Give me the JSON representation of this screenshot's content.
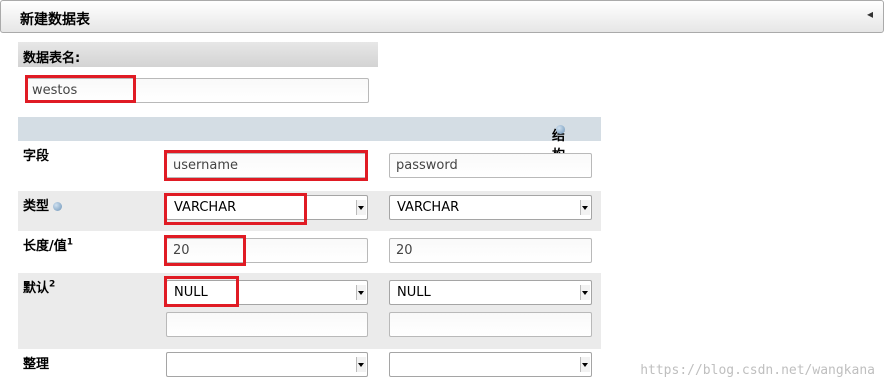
{
  "header": {
    "title": "新建数据表"
  },
  "table_name": {
    "label": "数据表名:",
    "value": "westos"
  },
  "structure": {
    "heading": "结构",
    "rows": {
      "field": {
        "label": "字段",
        "values": [
          "username",
          "password"
        ]
      },
      "type": {
        "label": "类型",
        "values": [
          "VARCHAR",
          "VARCHAR"
        ]
      },
      "length": {
        "label": "长度/值",
        "sup": "1",
        "values": [
          "20",
          "20"
        ]
      },
      "default": {
        "label": "默认",
        "sup": "2",
        "values": [
          "NULL",
          "NULL"
        ],
        "extra": [
          "",
          ""
        ]
      },
      "collation": {
        "label": "整理",
        "values": [
          "",
          ""
        ]
      }
    }
  },
  "watermark": "https://blog.csdn.net/wangkana",
  "colors": {
    "highlight": "#e01b24",
    "structure_header": "#d4dde4"
  }
}
